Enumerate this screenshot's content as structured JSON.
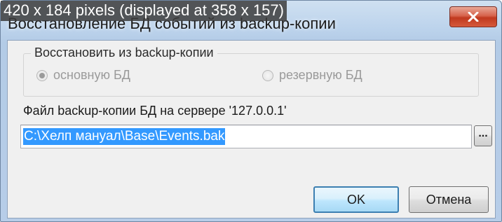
{
  "overlay": {
    "text": "420 x 184 pixels (displayed at 358 x 157)"
  },
  "window": {
    "title": "Восстановление БД событий из backup-копии",
    "close_symbol": "✕"
  },
  "restore_group": {
    "legend": "Восстановить из backup-копии",
    "options": [
      {
        "label": "основную БД",
        "selected": true,
        "enabled": false
      },
      {
        "label": "резервную БД",
        "selected": false,
        "enabled": false
      }
    ]
  },
  "file": {
    "label": "Файл backup-копии БД на сервере '127.0.0.1'",
    "path": "C:\\Хелп мануал\\Base\\Events.bak",
    "browse_label": "..."
  },
  "buttons": {
    "ok": "OK",
    "cancel": "Отмена"
  },
  "colors": {
    "selection": "#3399ff",
    "close_button": "#c0391f",
    "default_button_border": "#3c7fb1"
  }
}
